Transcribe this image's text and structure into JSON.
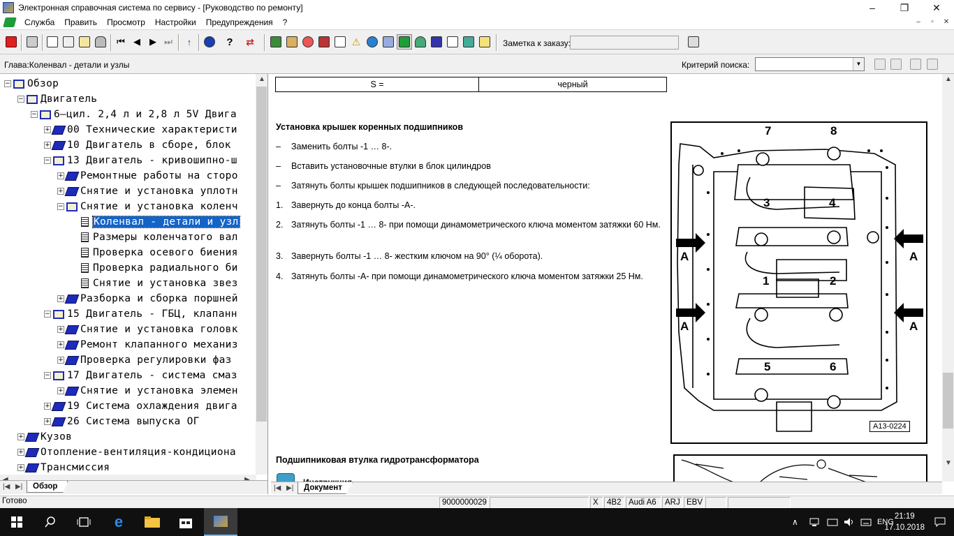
{
  "window": {
    "title": "Электронная справочная система по сервису - [Руководство по ремонту]",
    "minimize": "–",
    "maximize": "❐",
    "close": "✕"
  },
  "menu": {
    "items": [
      "Служба",
      "Править",
      "Просмотр",
      "Настройки",
      "Предупреждения",
      "?"
    ],
    "mdi": [
      "–",
      "▫",
      "✕"
    ]
  },
  "toolbar": {
    "order_label": "Заметка к заказу:",
    "order_value": ""
  },
  "chapter": {
    "label": "Глава:Коленвал - детали и узлы",
    "search_label": "Критерий  поиска:",
    "search_value": ""
  },
  "tree": {
    "rows": [
      {
        "text": "Обзор",
        "icon": "book-open",
        "exp": "−"
      },
      {
        "text": "Двигатель",
        "icon": "book-open",
        "exp": "−"
      },
      {
        "text": "6–цил. 2,4 л и 2,8 л 5V Двига",
        "icon": "book-open",
        "exp": "−"
      },
      {
        "text": "00 Технические характеристи",
        "icon": "book-closed",
        "exp": "+"
      },
      {
        "text": "10 Двигатель в сборе, блок",
        "icon": "book-closed",
        "exp": "+"
      },
      {
        "text": "13 Двигатель - кривошипно-ш",
        "icon": "book-open",
        "exp": "−"
      },
      {
        "text": "Ремонтные работы на сторо",
        "icon": "book-closed",
        "exp": "+"
      },
      {
        "text": "Снятие и установка уплотн",
        "icon": "book-closed",
        "exp": "+"
      },
      {
        "text": "Снятие и установка коленч",
        "icon": "book-open",
        "exp": "−"
      },
      {
        "text": "Коленвал - детали и узл",
        "icon": "doc",
        "exp": ""
      },
      {
        "text": "Размеры коленчатого вал",
        "icon": "doc",
        "exp": ""
      },
      {
        "text": "Проверка осевого биения",
        "icon": "doc",
        "exp": ""
      },
      {
        "text": "Проверка радиального би",
        "icon": "doc",
        "exp": ""
      },
      {
        "text": "Снятие и установка звез",
        "icon": "doc",
        "exp": ""
      },
      {
        "text": "Разборка и сборка поршней",
        "icon": "book-closed",
        "exp": "+"
      },
      {
        "text": "15 Двигатель - ГБЦ, клапанн",
        "icon": "book-open",
        "exp": "−"
      },
      {
        "text": "Снятие и установка головк",
        "icon": "book-closed",
        "exp": "+"
      },
      {
        "text": "Ремонт клапанного механиз",
        "icon": "book-closed",
        "exp": "+"
      },
      {
        "text": "Проверка регулировки фаз",
        "icon": "book-closed",
        "exp": "+"
      },
      {
        "text": "17 Двигатель - система смаз",
        "icon": "book-open",
        "exp": "−"
      },
      {
        "text": "Снятие и установка элемен",
        "icon": "book-closed",
        "exp": "+"
      },
      {
        "text": "19 Система охлаждения двига",
        "icon": "book-closed",
        "exp": "+"
      },
      {
        "text": "26 Система выпуска ОГ",
        "icon": "book-closed",
        "exp": "+"
      },
      {
        "text": "Кузов",
        "icon": "book-closed",
        "exp": "+"
      },
      {
        "text": "Отопление-вентиляция-кондициона",
        "icon": "book-closed",
        "exp": "+"
      },
      {
        "text": "Трансмиссия",
        "icon": "book-closed",
        "exp": "+"
      }
    ],
    "tab": "Обзор"
  },
  "document": {
    "table": {
      "col1": "S  =",
      "col2": "черный"
    },
    "section1_title": "Установка крышек коренных подшипников",
    "bullets": [
      "Заменить болты -1 … 8-.",
      "Вставить установочные втулки в блок цилиндров",
      "Затянуть болты крышек подшипников в следующей последовательности:"
    ],
    "steps": [
      {
        "num": "1.",
        "text": "Завернуть до конца болты -A-."
      },
      {
        "num": "2.",
        "text": "Затянуть болты -1 … 8- при помощи динамометрического ключа моментом затяжки 60 Нм."
      },
      {
        "num": "3.",
        "text": "Завернуть болты -1 … 8- жестким ключом на 90° (¼ оборота)."
      },
      {
        "num": "4.",
        "text": "Затянуть болты -A- при помощи динамометрического ключа моментом затяжки 25 Нм."
      }
    ],
    "figure_labels": [
      "7",
      "8",
      "3",
      "4",
      "1",
      "2",
      "5",
      "6",
      "A",
      "A",
      "A",
      "A"
    ],
    "figure_code": "A13-0224",
    "section2_title": "Подшипниковая втулка гидротрансформатора",
    "instruction_label": "Инструкция",
    "tab": "Документ"
  },
  "status": {
    "ready": "Готово",
    "number": "9000000029",
    "x": "X",
    "code1": "4B2",
    "model": "Audi A6",
    "engine": "ARJ",
    "code2": "EBV"
  },
  "taskbar": {
    "lang": "ENG",
    "time": "21:19",
    "date": "17.10.2018"
  }
}
